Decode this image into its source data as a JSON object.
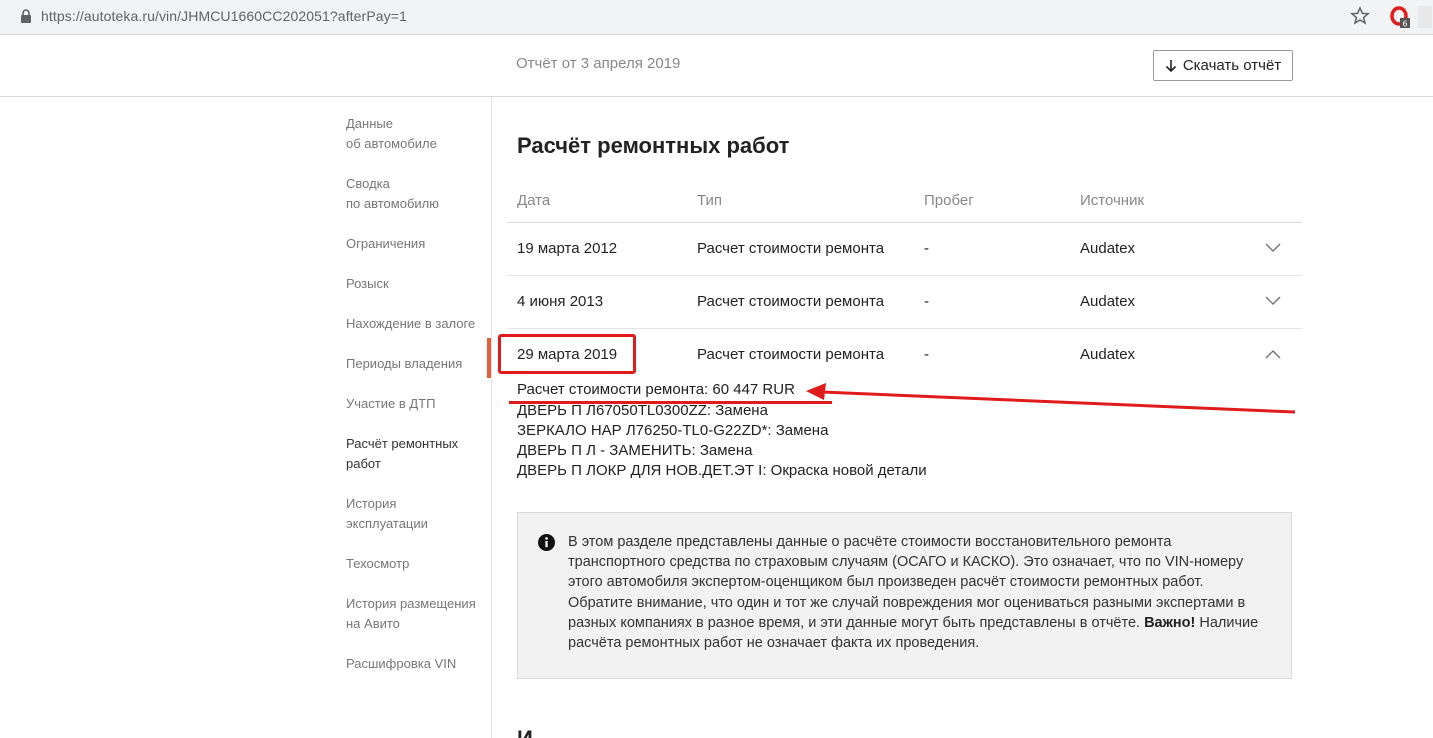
{
  "browser": {
    "url": "https://autoteka.ru/vin/JHMCU1660CC202051?afterPay=1",
    "extension_badge": "6"
  },
  "header": {
    "report_date": "Отчёт от 3 апреля 2019",
    "download_label": "Скачать отчёт"
  },
  "sidebar": {
    "items": [
      {
        "line1": "Данные",
        "line2": "об автомобиле"
      },
      {
        "line1": "Сводка",
        "line2": "по автомобилю"
      },
      {
        "line1": "Ограничения",
        "line2": ""
      },
      {
        "line1": "Розыск",
        "line2": ""
      },
      {
        "line1": "Нахождение в залоге",
        "line2": ""
      },
      {
        "line1": "Периоды владения",
        "line2": ""
      },
      {
        "line1": "Участие в ДТП",
        "line2": ""
      },
      {
        "line1": "Расчёт ремонтных",
        "line2": "работ"
      },
      {
        "line1": "История",
        "line2": "эксплуатации"
      },
      {
        "line1": "Техосмотр",
        "line2": ""
      },
      {
        "line1": "История размещения",
        "line2": "на Авито"
      },
      {
        "line1": "Расшифровка VIN",
        "line2": ""
      }
    ]
  },
  "section": {
    "title": "Расчёт ремонтных работ",
    "columns": [
      "Дата",
      "Тип",
      "Пробег",
      "Источник"
    ],
    "rows": [
      {
        "date": "19 марта 2012",
        "type": "Расчет стоимости ремонта",
        "mileage": "-",
        "source": "Audatex"
      },
      {
        "date": "4 июня 2013",
        "type": "Расчет стоимости ремонта",
        "mileage": "-",
        "source": "Audatex"
      },
      {
        "date": "29 марта 2019",
        "type": "Расчет стоимости ремонта",
        "mileage": "-",
        "source": "Audatex"
      }
    ],
    "details": [
      "Расчет стоимости ремонта: 60 447 RUR",
      "ДВЕРЬ П Л67050TL0300ZZ: Замена",
      "ЗЕРКАЛО НАР Л76250-TL0-G22ZD*: Замена",
      "ДВЕРЬ П Л - ЗАМЕНИТЬ: Замена",
      "ДВЕРЬ П ЛОКР ДЛЯ НОВ.ДЕТ.ЭТ I: Окраска новой детали"
    ],
    "info_text": "В этом разделе представлены данные о расчёте стоимости восстановительного ремонта транспортного средства по страховым случаям (ОСАГО и КАСКО). Это означает, что по VIN-номеру этого автомобиля экспертом-оценщиком был произведен расчёт стоимости ремонтных работ. Обратите внимание, что один и тот же случай повреждения мог оцениваться разными экспертами в разных компаниях в разное время, и эти данные могут быть представлены в отчёте.",
    "info_important": "Важно!",
    "info_important_text": " Наличие расчёта ремонтных работ не означает факта их проведения.",
    "next_title": "И"
  },
  "colors": {
    "accent": "#e85c3c",
    "annotation": "#e01b1b"
  }
}
